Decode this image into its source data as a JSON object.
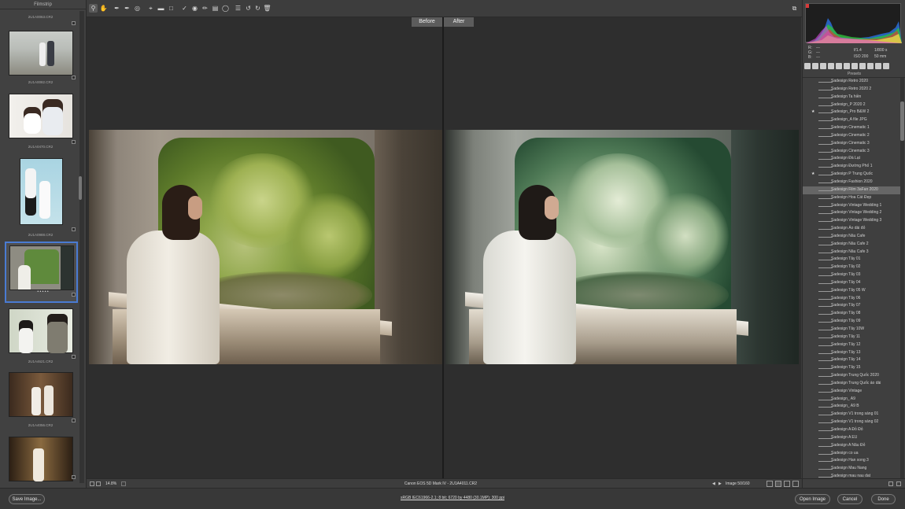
{
  "filmstrip": {
    "title": "Filmstrip",
    "items": [
      {
        "caption": "2U1A0063.CR2"
      },
      {
        "caption": "2U1A0082.CR2"
      },
      {
        "caption": "2U1A0470.CR2"
      },
      {
        "caption": "2U1A0988.CR2"
      },
      {
        "caption": "2U1A4011.CR2"
      },
      {
        "caption": "2U1A4621.CR2"
      },
      {
        "caption": "2U1A4056.CR2"
      },
      {
        "caption": ""
      }
    ],
    "selected_index": 4,
    "rating_dots": "• • • • •"
  },
  "toolbar": {
    "tools": [
      "zoom-icon",
      "hand-icon",
      "white-balance-icon",
      "color-sampler-icon",
      "target-adjust-icon",
      "crop-icon",
      "straighten-icon",
      "transform-icon",
      "spot-removal-icon",
      "red-eye-icon",
      "adjustment-brush-icon",
      "graduated-filter-icon",
      "radial-filter-icon",
      "preferences-icon",
      "rotate-ccw-icon",
      "rotate-cw-icon",
      "trash-icon"
    ],
    "right_tool": "fullscreen-icon"
  },
  "preview": {
    "before_label": "Before",
    "after_label": "After"
  },
  "status": {
    "zoom": "14.8%",
    "camera": "Canon EOS 5D Mark IV  -  2U1A4011.CR2",
    "image_counter": "Image 50/160"
  },
  "right_panel": {
    "rgb": {
      "r_label": "R:",
      "g_label": "G:",
      "b_label": "B:",
      "r": "---",
      "g": "---",
      "b": "---"
    },
    "exif": {
      "aperture": "f/1.4",
      "shutter": "1/800 s",
      "iso": "ISO 200",
      "focal": "50 mm"
    },
    "presets_title": "Presets",
    "presets": [
      "Sadesign Retro 2020",
      "Sadesign Retro 2020 2",
      "Sadesign Ta hiền",
      "Sadesign_P 2020 2",
      "Sadesign_Pro B&W 2",
      "Sadesign_A file JPG",
      "Sadesign Cinematic 1",
      "Sadesign Cinematic 2",
      "Sadesign Cinematic 3",
      "Sadesign Cinematic 3",
      "Sadesign Đà Lạt",
      "Sadesign Đường Phố 1",
      "Sadesign P Trung Quốc",
      "Sadesign Fashion 2020",
      "Sadesign Film 3aFan 2020",
      "Sadesign Hoa Cát Đẹp",
      "Sadesign Vintage Wedding 1",
      "Sadesign Vintage Wedding 2",
      "Sadesign Vintage Wedding 3",
      "Sadesign Áo dài đỏ",
      "Sadesign Nâu Cafe",
      "Sadesign Nâu Cafe 2",
      "Sadesign Nâu Cafe 3",
      "Sadesign Tây 01",
      "Sadesign Tây 02",
      "Sadesign Tây 03",
      "Sadesign Tây 04",
      "Sadesign Tây 05 W",
      "Sadesign Tây 06",
      "Sadesign Tây 07",
      "Sadesign Tây 08",
      "Sadesign Tây 09",
      "Sadesign Tây 10W",
      "Sadesign Tây 11",
      "Sadesign Tây 12",
      "Sadesign Tây 13",
      "Sadesign Tây 14",
      "Sadesign Tây 15",
      "Sadesign Trung Quốc 2020",
      "Sadesign Trung Quốc áo dài",
      "Sadesign Vintage",
      "Sadesign_ A9",
      "Sadesign_ A9 B",
      "Sadesign V1 trong sáng 01",
      "Sadesign V1 trong sáng 02",
      "Sadesign    A Đỏ Đỏ",
      "Sadesign    A EU",
      "Sadesign    A Nâu Đỏ",
      "Sadesign    co ua",
      "Sadesign    Han xong 3",
      "Sadesign    Mau Nang",
      "Sadesign    mau nau dat"
    ],
    "starred": [
      4,
      12
    ],
    "selected_preset": 14
  },
  "bottom": {
    "save_label": "Save Image...",
    "workflow_link": "sRGB IEC61966-2.1; 8 bit; 6720 by 4480 (30.1MP); 300 ppi",
    "open_label": "Open Image",
    "cancel_label": "Cancel",
    "done_label": "Done"
  },
  "colors": {
    "selection_blue": "#4a7bd2",
    "panel": "#3f3f3f"
  }
}
